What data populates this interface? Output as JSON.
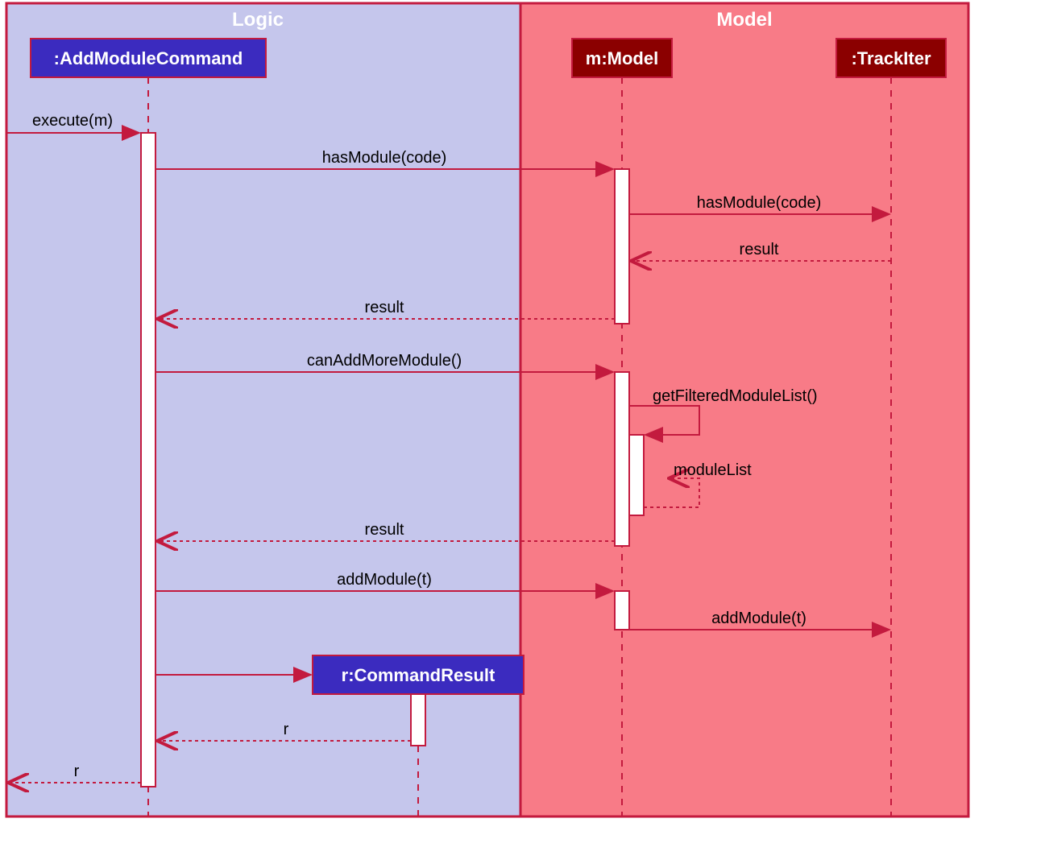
{
  "regions": {
    "logic": "Logic",
    "model": "Model"
  },
  "participants": {
    "addModuleCommand": ":AddModuleCommand",
    "model": "m:Model",
    "trackIter": ":TrackIter",
    "commandResult": "r:CommandResult"
  },
  "messages": {
    "execute": "execute(m)",
    "hasModule1": "hasModule(code)",
    "hasModule2": "hasModule(code)",
    "result1": "result",
    "result2": "result",
    "canAddMoreModule": "canAddMoreModule()",
    "getFilteredModuleList": "getFilteredModuleList()",
    "moduleList": "moduleList",
    "result3": "result",
    "addModule1": "addModule(t)",
    "addModule2": "addModule(t)",
    "returnR1": "r",
    "returnR2": "r"
  }
}
